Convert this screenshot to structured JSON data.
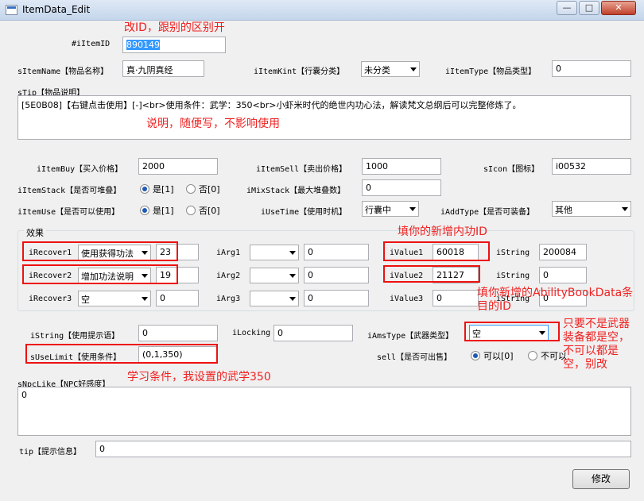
{
  "window": {
    "title": "ItemData_Edit",
    "minimize_glyph": "—",
    "maximize_glyph": "□",
    "close_glyph": "✕"
  },
  "fields": {
    "iItemID": {
      "label": "#iItemID",
      "value": "890149"
    },
    "sItemName": {
      "label": "sItemName【物品名称】",
      "value": "真·九阴真经"
    },
    "iItemKint": {
      "label": "iItemKint【行囊分类】",
      "value": "未分类"
    },
    "iItemType": {
      "label": "iItemType【物品类型】",
      "value": "0"
    },
    "sTip": {
      "label": "sTip【物品说明】",
      "value": "[5E0B08]【右键点击使用】[-]<br>使用条件：武学：350<br>小虾米时代的绝世内功心法，解读梵文总纲后可以完整修炼了。"
    },
    "iItemBuy": {
      "label": "iItemBuy【买入价格】",
      "value": "2000"
    },
    "iItemSell": {
      "label": "iItemSell【卖出价格】",
      "value": "1000"
    },
    "sIcon": {
      "label": "sIcon【图标】",
      "value": "i00532"
    },
    "iItemStack": {
      "label": "iItemStack【是否可堆叠】",
      "opt_yes": "是[1]",
      "opt_no": "否[0]",
      "selected": "是[1]"
    },
    "iMixStack": {
      "label": "iMixStack【最大堆叠数】",
      "value": "0"
    },
    "iItemUse": {
      "label": "iItemUse【是否可以使用】",
      "opt_yes": "是[1]",
      "opt_no": "否[0]",
      "selected": "是[1]"
    },
    "iUseTime": {
      "label": "iUseTime【使用时机】",
      "value": "行囊中"
    },
    "iAddType": {
      "label": "iAddType【是否可装备】",
      "value": "其他"
    },
    "effects_group": {
      "title": "效果"
    },
    "iRecover1": {
      "label": "iRecover1",
      "combo": "使用获得功法",
      "value": "23"
    },
    "iRecover2": {
      "label": "iRecover2",
      "combo": "增加功法说明",
      "value": "19"
    },
    "iRecover3": {
      "label": "iRecover3",
      "combo": "空",
      "value": "0"
    },
    "iArg1": {
      "label": "iArg1",
      "combo": "",
      "value": "0"
    },
    "iArg2": {
      "label": "iArg2",
      "combo": "",
      "value": "0"
    },
    "iArg3": {
      "label": "iArg3",
      "combo": "",
      "value": "0"
    },
    "iValue1": {
      "label": "iValue1",
      "value": "60018"
    },
    "iValue2": {
      "label": "iValue2",
      "value": "21127"
    },
    "iValue3": {
      "label": "iValue3",
      "value": "0"
    },
    "iString1": {
      "label": "iString",
      "value": "200084"
    },
    "iString2": {
      "label": "iString",
      "value": "0"
    },
    "iString3": {
      "label": "iString",
      "value": "0"
    },
    "iStringUse": {
      "label": "iString【使用提示语】",
      "value": "0"
    },
    "iLocking": {
      "label": "iLocking",
      "value": "0"
    },
    "iAmsType": {
      "label": "iAmsType【武器类型】",
      "value": "空"
    },
    "sUseLimit": {
      "label": "sUseLimit【使用条件】",
      "value": "(0,1,350)"
    },
    "sell": {
      "label": "sell【是否可出售】",
      "opt_yes": "可以[0]",
      "opt_no": "不可以",
      "selected": "可以[0]"
    },
    "sNpcLike": {
      "label": "sNpcLike【NPC好感度】",
      "value": "0"
    },
    "tip": {
      "label": "tip【提示信息】",
      "value": "0"
    }
  },
  "buttons": {
    "modify": "修改"
  },
  "annotations": {
    "a1": "改ID，跟别的区别开",
    "a2": "说明，随便写，不影响使用",
    "a3": "填你的新增内功ID",
    "a4": "填你新增的AbilityBookData条目的ID",
    "a5": "只要不是武器装备都是空，不可以都是空，别改",
    "a6": "学习条件，我设置的武学350"
  },
  "colors": {
    "annotation": "#f02020",
    "selection": "#3399ff"
  }
}
